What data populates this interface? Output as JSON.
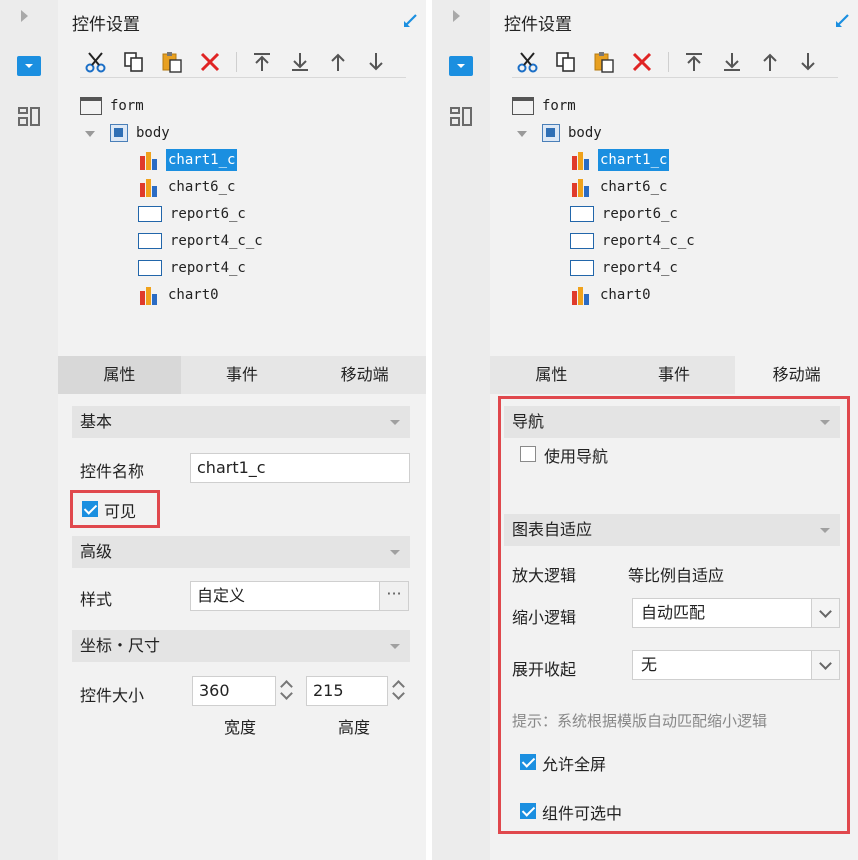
{
  "title": "控件设置",
  "tree": {
    "root": "form",
    "body": "body",
    "children": [
      "chart1_c",
      "chart6_c",
      "report6_c",
      "report4_c_c",
      "report4_c",
      "chart0"
    ],
    "selected": "chart1_c"
  },
  "tabs": [
    "属性",
    "事件",
    "移动端"
  ],
  "left": {
    "basic_header": "基本",
    "name_label": "控件名称",
    "name_value": "chart1_c",
    "visible_label": "可见",
    "advanced_header": "高级",
    "style_label": "样式",
    "style_value": "自定义",
    "style_button": "···",
    "coord_header": "坐标・尺寸",
    "size_label": "控件大小",
    "width_value": "360",
    "height_value": "215",
    "width_caption": "宽度",
    "height_caption": "高度"
  },
  "right": {
    "nav_header": "导航",
    "use_nav_label": "使用导航",
    "adaptive_header": "图表自适应",
    "zoom_in_label": "放大逻辑",
    "zoom_in_value": "等比例自适应",
    "zoom_out_label": "缩小逻辑",
    "zoom_out_value": "自动匹配",
    "expand_label": "展开收起",
    "expand_value": "无",
    "hint": "提示：系统根据模版自动匹配缩小逻辑",
    "fullscreen_label": "允许全屏",
    "selectable_label": "组件可选中"
  },
  "colors": {
    "accent": "#1b8fe0",
    "highlight": "#e0484d"
  }
}
